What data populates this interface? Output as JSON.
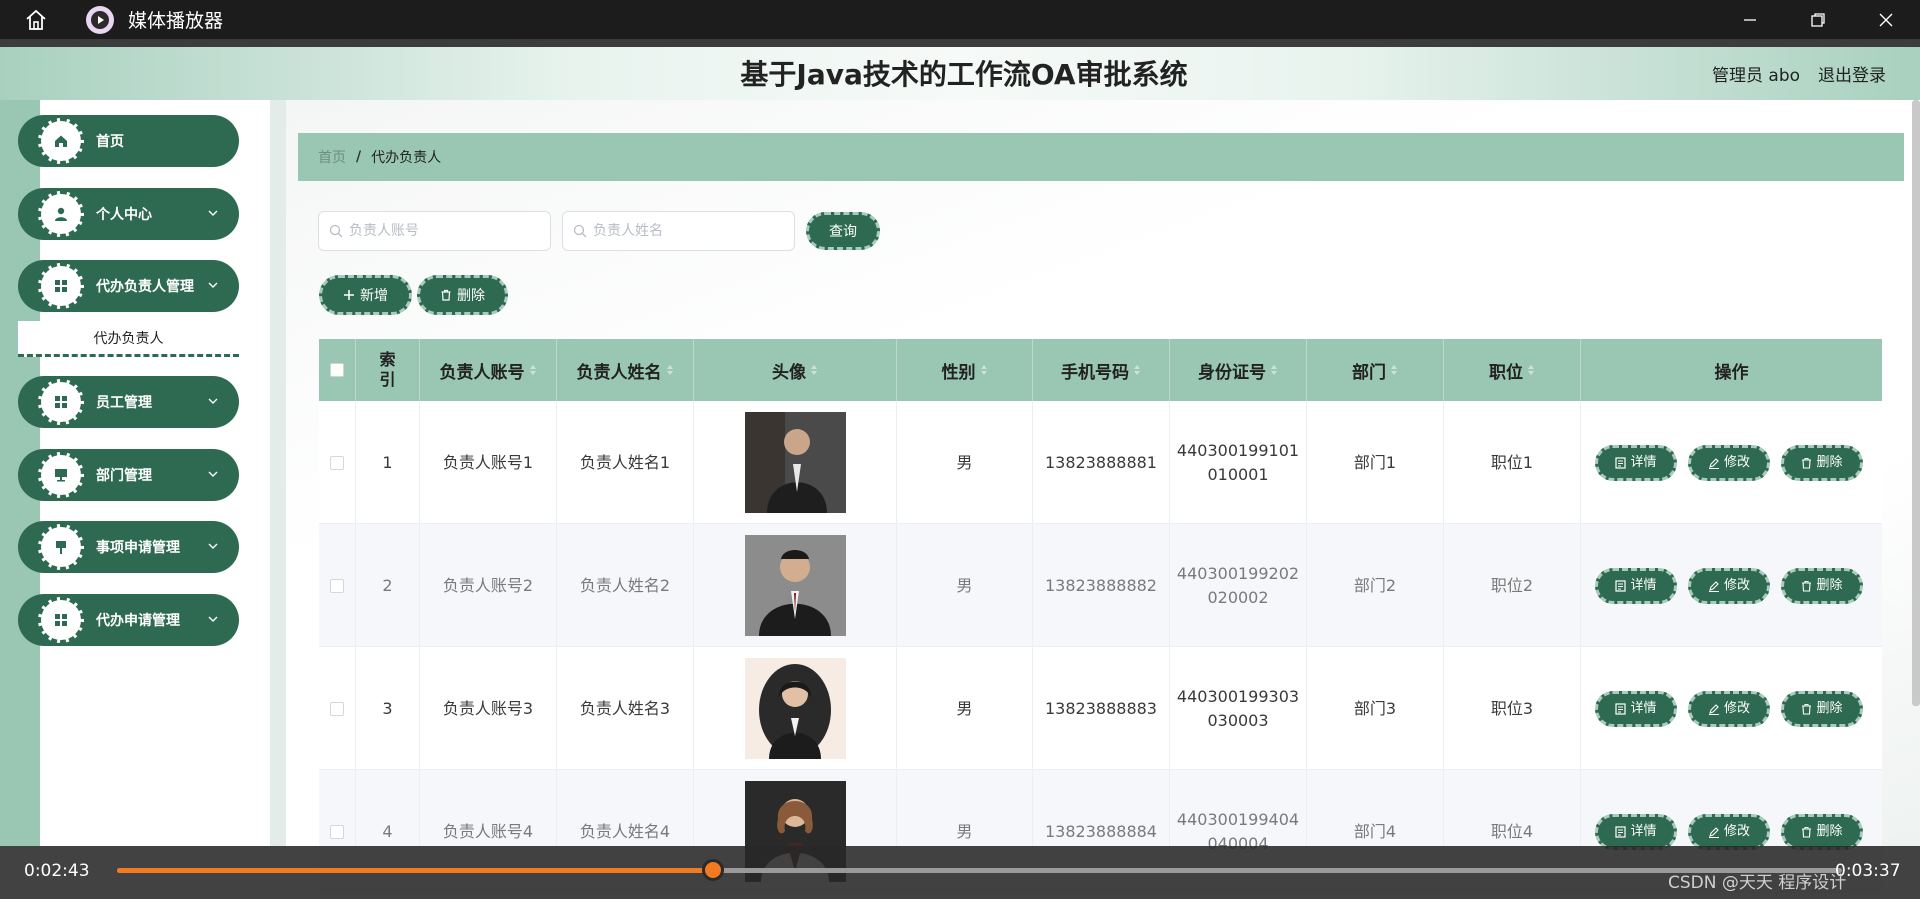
{
  "window": {
    "title": "媒体播放器"
  },
  "header": {
    "title": "基于Java技术的工作流OA审批系统",
    "user": "管理员 abo",
    "logout": "退出登录"
  },
  "sidebar": {
    "items": [
      {
        "label": "首页",
        "icon": "home-icon"
      },
      {
        "label": "个人中心",
        "icon": "user-icon"
      },
      {
        "label": "代办负责人管理",
        "icon": "grid-icon"
      },
      {
        "label": "员工管理",
        "icon": "grid-icon"
      },
      {
        "label": "部门管理",
        "icon": "monitor-icon"
      },
      {
        "label": "事项申请管理",
        "icon": "flag-icon"
      },
      {
        "label": "代办申请管理",
        "icon": "grid-icon"
      }
    ],
    "submenu": {
      "label": "代办负责人"
    }
  },
  "breadcrumb": {
    "home": "首页",
    "separator": "/",
    "current": "代办负责人"
  },
  "search": {
    "account_placeholder": "负责人账号",
    "name_placeholder": "负责人姓名",
    "query": "查询"
  },
  "actions": {
    "add": "新增",
    "delete": "删除"
  },
  "table": {
    "headers": [
      "索引",
      "负责人账号",
      "负责人姓名",
      "头像",
      "性别",
      "手机号码",
      "身份证号",
      "部门",
      "职位",
      "操作"
    ],
    "rows": [
      {
        "index": "1",
        "account": "负责人账号1",
        "name": "负责人姓名1",
        "gender": "男",
        "phone": "13823888881",
        "id_line1": "440300199101",
        "id_line2": "010001",
        "dept": "部门1",
        "position": "职位1"
      },
      {
        "index": "2",
        "account": "负责人账号2",
        "name": "负责人姓名2",
        "gender": "男",
        "phone": "13823888882",
        "id_line1": "440300199202",
        "id_line2": "020002",
        "dept": "部门2",
        "position": "职位2"
      },
      {
        "index": "3",
        "account": "负责人账号3",
        "name": "负责人姓名3",
        "gender": "男",
        "phone": "13823888883",
        "id_line1": "440300199303",
        "id_line2": "030003",
        "dept": "部门3",
        "position": "职位3"
      },
      {
        "index": "4",
        "account": "负责人账号4",
        "name": "负责人姓名4",
        "gender": "男",
        "phone": "13823888884",
        "id_line1": "440300199404",
        "id_line2": "040004",
        "dept": "部门4",
        "position": "职位4"
      }
    ],
    "ops": {
      "detail": "详情",
      "edit": "修改",
      "delete": "删除"
    }
  },
  "player": {
    "current_time": "0:02:43",
    "total_time": "0:03:37",
    "progress": 0.3455,
    "watermark": "CSDN @天天 程序设计"
  },
  "colors": {
    "accent": "#2e6a52",
    "header_green": "#9ac7b3",
    "progress": "#f27b21"
  }
}
